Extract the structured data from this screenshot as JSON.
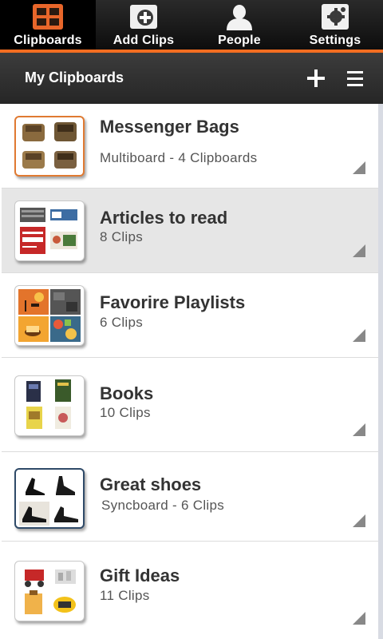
{
  "tabs": [
    {
      "label": "Clipboards",
      "icon": "clipboards-grid-icon",
      "active": true
    },
    {
      "label": "Add Clips",
      "icon": "add-clip-icon",
      "active": false
    },
    {
      "label": "People",
      "icon": "person-icon",
      "active": false
    },
    {
      "label": "Settings",
      "icon": "settings-gear-icon",
      "active": false
    }
  ],
  "header": {
    "title": "My Clipboards",
    "add_icon": "plus-icon",
    "menu_icon": "menu-lines-icon"
  },
  "colors": {
    "accent": "#f26d21",
    "selected_row": "#e6e6e6"
  },
  "clipboards": [
    {
      "title": "Messenger Bags",
      "subtitle": "Multiboard - 4 Clipboards"
    },
    {
      "title": "Articles to read",
      "subtitle": "8 Clips"
    },
    {
      "title": "Favorire Playlists",
      "subtitle": "6 Clips"
    },
    {
      "title": "Books",
      "subtitle": "10 Clips"
    },
    {
      "title": "Great shoes",
      "subtitle": "Syncboard - 6 Clips"
    },
    {
      "title": "Gift Ideas",
      "subtitle": "11 Clips"
    }
  ]
}
